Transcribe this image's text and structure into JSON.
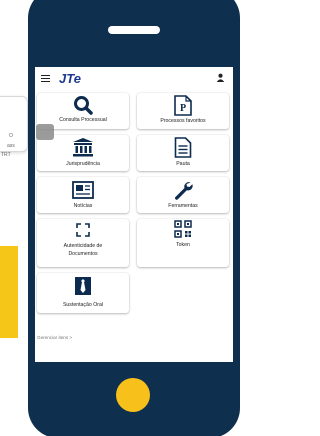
{
  "app": {
    "logo": "JTe"
  },
  "side_card": {
    "line1": "O",
    "line2": "ass",
    "line3": "TRT"
  },
  "menu_tiles": [
    {
      "label": "Consulta Processual",
      "icon": "search-icon"
    },
    {
      "label": "Processos favoritos",
      "icon": "favorite-process-icon"
    },
    {
      "label": "Jurisprudência",
      "icon": "courthouse-icon"
    },
    {
      "label": "Pauta",
      "icon": "document-icon"
    },
    {
      "label": "Notícias",
      "icon": "newspaper-icon"
    },
    {
      "label": "Ferramentas",
      "icon": "wrench-icon"
    },
    {
      "label": "Autenticidade de Documentos",
      "label_line1": "Autenticidade de",
      "label_line2": "Documentos",
      "icon": "scan-icon"
    },
    {
      "label": "Token",
      "icon": "qr-code-icon"
    },
    {
      "label": "Sustentação Oral",
      "icon": "necktie-icon"
    }
  ],
  "footer": {
    "manage_link": "Gerenciar itens >"
  },
  "colors": {
    "phone_body": "#0f2f4e",
    "accent_yellow": "#f7c01a",
    "brand_blue": "#1a3a8f",
    "icon_navy": "#0d2b4e"
  }
}
